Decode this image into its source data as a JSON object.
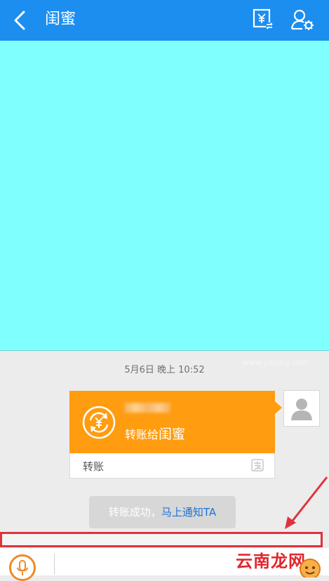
{
  "header": {
    "title": "闺蜜",
    "back_icon": "chevron-left-icon",
    "transfer_icon": "yen-transfer-icon",
    "settings_icon": "user-settings-icon",
    "color": "#1b8ef0"
  },
  "content_area": {
    "color": "#80ffff"
  },
  "chat": {
    "timestamp": "5月6日 晚上 10:52",
    "transfer_card": {
      "description_prefix": "转账给",
      "recipient": "闺蜜",
      "footer_label": "转账",
      "icon": "yen-cycle-icon",
      "footer_icon": "alipay-icon",
      "color": "#ff9c0f"
    },
    "notify": {
      "prefix": "转账成功，",
      "link": "马上通知TA"
    }
  },
  "watermark": {
    "text": "云南龙网",
    "url": "www.ynlong.com"
  },
  "annotation": {
    "color": "#e0323c"
  }
}
